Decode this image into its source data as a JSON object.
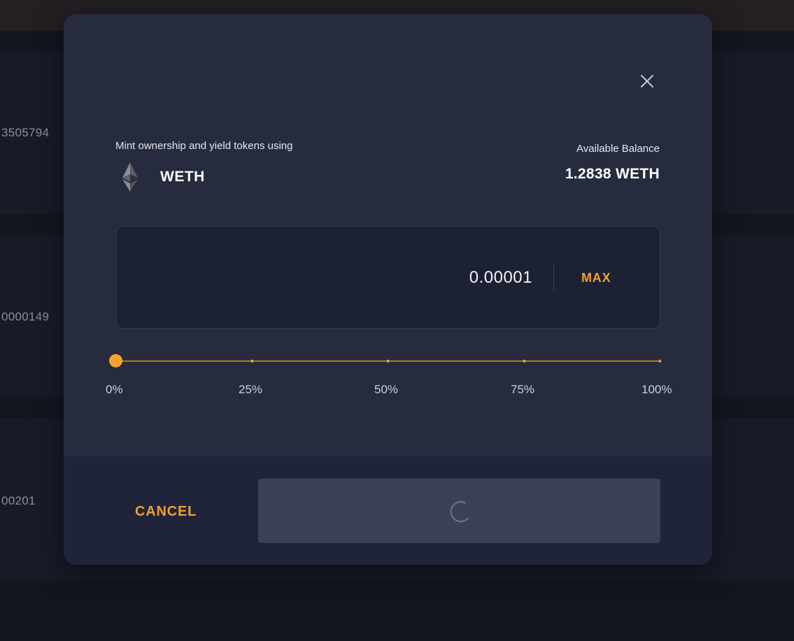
{
  "background": {
    "row_values": [
      "3505794",
      "0000149",
      "00201"
    ]
  },
  "modal": {
    "mint_label": "Mint ownership and yield tokens using",
    "token": {
      "name": "WETH",
      "icon": "ethereum-icon"
    },
    "balance": {
      "label": "Available Balance",
      "value": "1.2838 WETH"
    },
    "amount": {
      "value": "0.00001",
      "max_label": "MAX"
    },
    "slider": {
      "value_percent": 0,
      "ticks": [
        "0%",
        "25%",
        "50%",
        "75%",
        "100%"
      ]
    },
    "footer": {
      "cancel_label": "CANCEL",
      "confirm_state": "loading",
      "spinner_icon": "loading-spinner-icon"
    }
  },
  "colors": {
    "accent": "#f0a030",
    "modal_bg": "#262b3d",
    "input_bg": "#1d2134",
    "button_disabled": "#3b4156"
  }
}
